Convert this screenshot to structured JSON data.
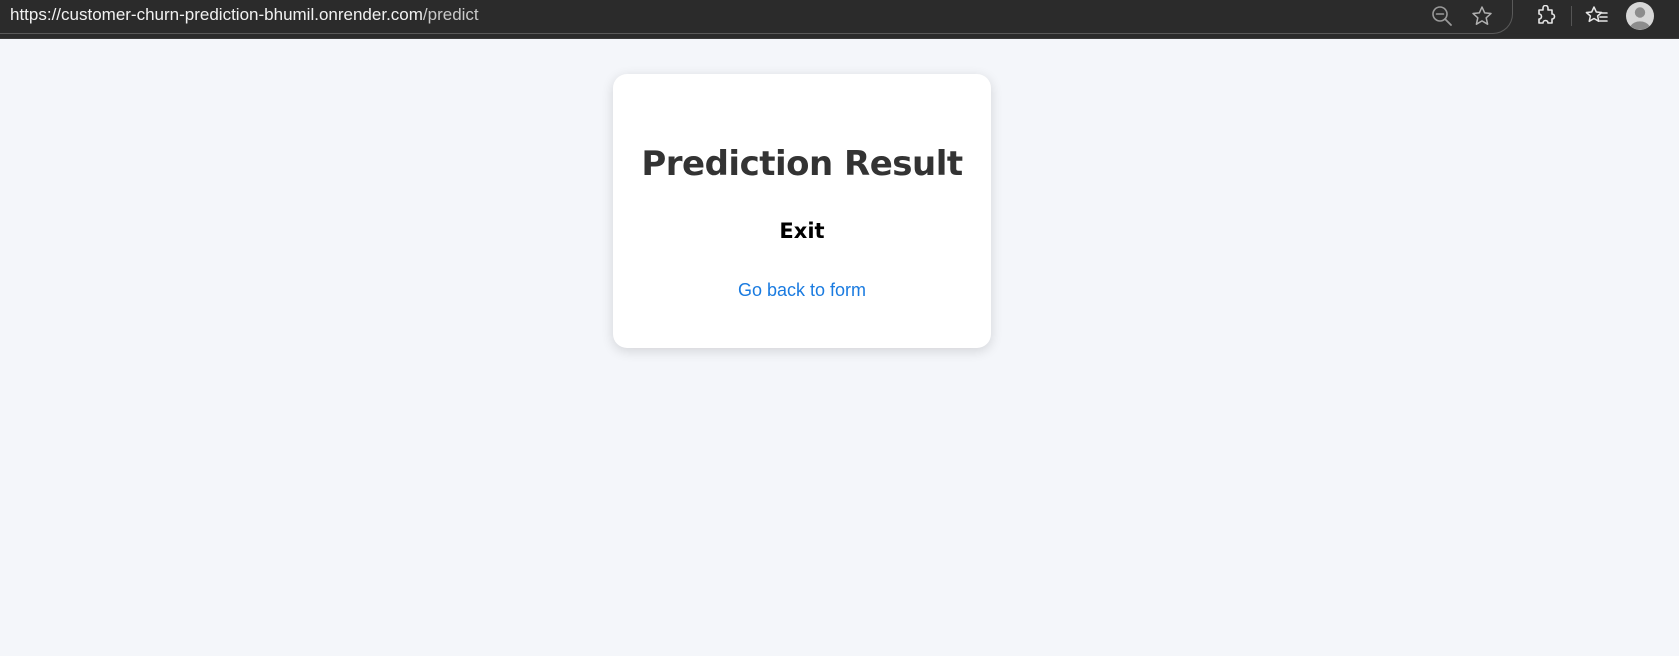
{
  "browser": {
    "url_host": "https://customer-churn-prediction-bhumil.onrender.com",
    "url_path": "/predict",
    "icons": [
      "lock-icon",
      "zoom-out-icon",
      "star-icon",
      "extensions-icon",
      "favorites-icon",
      "profile-icon"
    ]
  },
  "card": {
    "title": "Prediction Result",
    "result": "Exit",
    "back_link": "Go back to form"
  },
  "colors": {
    "page_background": "#f4f6fa",
    "card_background": "#ffffff",
    "title": "#333333",
    "result": "#000000",
    "link": "#1a7be0",
    "toolbar": "#2b2b2b"
  }
}
